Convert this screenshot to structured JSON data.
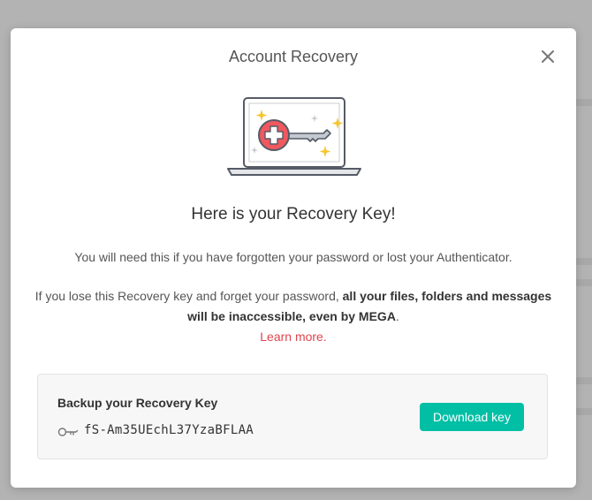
{
  "dialog": {
    "title": "Account Recovery",
    "close_icon": "close-icon",
    "illustration_icon": "laptop-recovery-key-illustration",
    "heading": "Here is your Recovery Key!",
    "description_1": "You will need this if you have forgotten your password or lost your Authenticator.",
    "description_2_plain": "If you lose this Recovery key and forget your password, ",
    "description_2_bold": "all your files, folders and messages will be inaccessible, even by MEGA",
    "description_2_end": ".",
    "learn_more": "Learn more."
  },
  "backup": {
    "title": "Backup your Recovery Key",
    "key_icon": "key-icon",
    "key_value": "fS-Am35UEchL37YzaBFLAA",
    "download_label": "Download key"
  },
  "colors": {
    "accent_teal": "#00bfa5",
    "link_red": "#e0444f",
    "illustration_red": "#f0585f",
    "sparkle_yellow": "#f7c52d"
  }
}
